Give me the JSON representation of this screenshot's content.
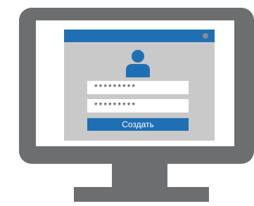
{
  "colors": {
    "accent": "#1f6fb5",
    "monitor": "#6d6e70",
    "window_bg": "#c9c9c9"
  },
  "icons": {
    "avatar": "user-icon",
    "close": "close-dot-icon"
  },
  "form": {
    "password_value": "*********",
    "confirm_value": "*********",
    "create_label": "Создать"
  }
}
